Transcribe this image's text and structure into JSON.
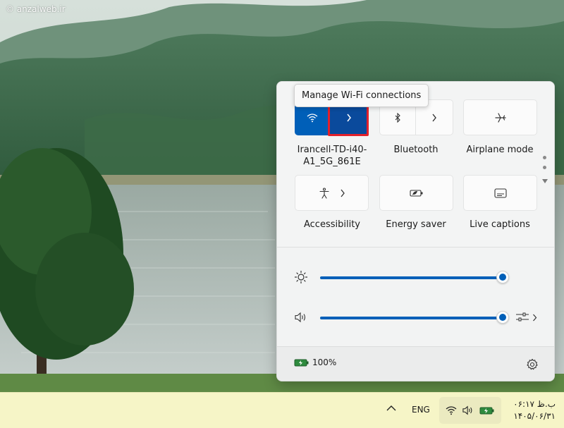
{
  "watermark": {
    "text": "© anzalweb.ir"
  },
  "tooltip": {
    "text": "Manage Wi-Fi connections"
  },
  "tiles": {
    "wifi": {
      "label_line1": "Irancell-TD-i40-",
      "label_line2": "A1_5G_861E",
      "icon": "wifi-icon",
      "state": "on"
    },
    "bluetooth": {
      "label": "Bluetooth",
      "icon": "bluetooth-icon",
      "state": "off"
    },
    "airplane": {
      "label": "Airplane mode",
      "icon": "airplane-icon"
    },
    "accessibility": {
      "label": "Accessibility",
      "icon": "accessibility-icon"
    },
    "energy_saver": {
      "label": "Energy saver",
      "icon": "energy-saver-icon"
    },
    "live_captions": {
      "label": "Live captions",
      "icon": "captions-icon"
    }
  },
  "sliders": {
    "brightness": {
      "value": 100,
      "icon": "brightness-icon"
    },
    "volume": {
      "value": 100,
      "icon": "speaker-icon"
    }
  },
  "footer": {
    "battery_text": "100%",
    "settings_icon": "gear-icon"
  },
  "taskbar": {
    "lang": "ENG",
    "time": "۰۶:۱۷ ب.ظ",
    "date": "۱۴۰۵/۰۶/۳۱"
  },
  "colors": {
    "accent": "#005fb8",
    "accent_dark": "#0a4a9c",
    "highlight": "#e2202b",
    "taskbar": "#f6f5c7"
  }
}
